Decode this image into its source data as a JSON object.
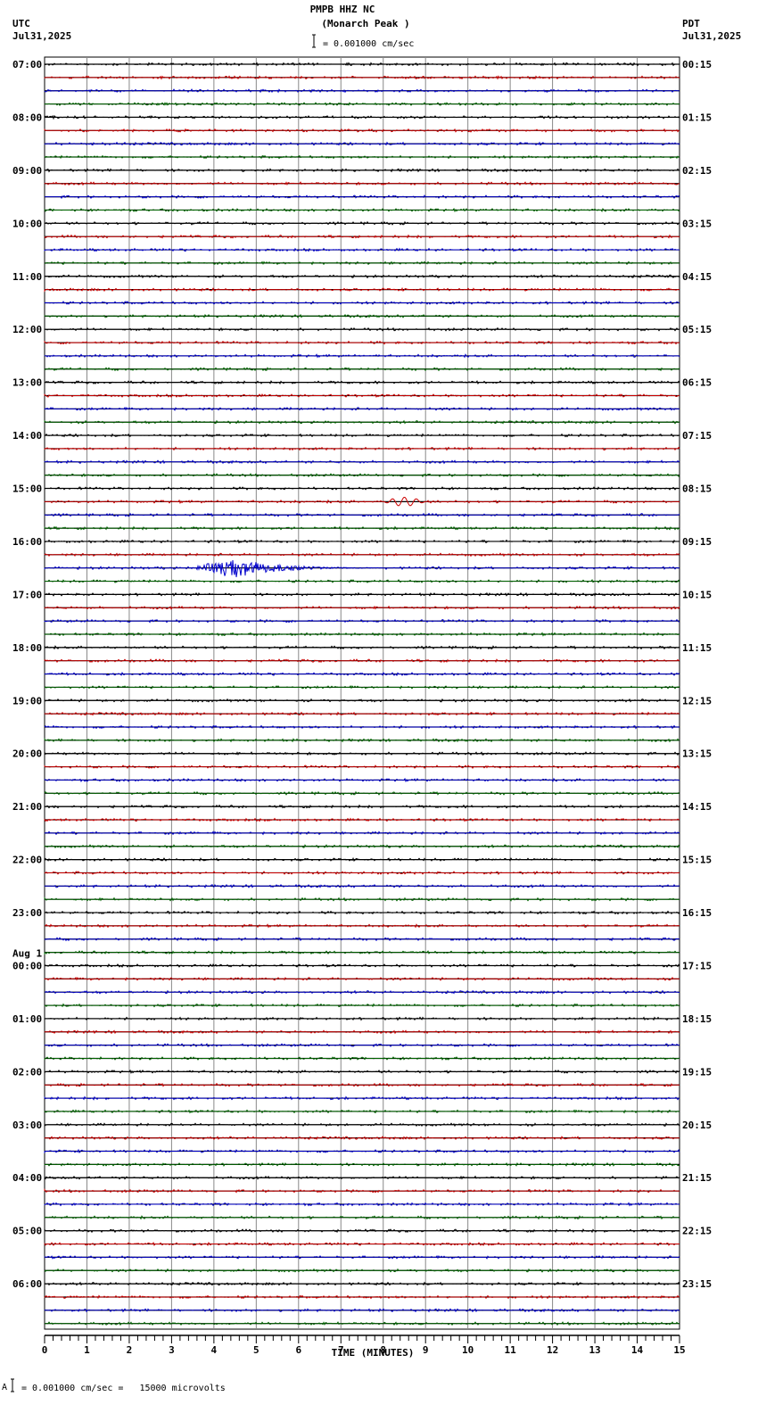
{
  "header": {
    "station": "PMPB HHZ NC",
    "location": "(Monarch Peak )",
    "left_tz": "UTC",
    "left_date": "Jul31,2025",
    "right_tz": "PDT",
    "right_date": "Jul31,2025",
    "scale_text": "= 0.001000 cm/sec"
  },
  "footer": {
    "scale_prefix": "A",
    "scale_text": "= 0.001000 cm/sec =   15000 microvolts"
  },
  "chart_data": {
    "type": "line",
    "title": "PMPB HHZ NC (Monarch Peak )",
    "xlabel": "TIME (MINUTES)",
    "xlim": [
      0,
      15
    ],
    "x_ticks": [
      "0",
      "1",
      "2",
      "3",
      "4",
      "5",
      "6",
      "7",
      "8",
      "9",
      "10",
      "11",
      "12",
      "13",
      "14",
      "15"
    ],
    "traces_per_hour": 4,
    "trace_count": 96,
    "trace_colors": [
      "#000000",
      "#cc0000",
      "#0000cc",
      "#006600"
    ],
    "date_change_label": "Aug 1",
    "date_change_before": "00:00",
    "left_labels": [
      "07:00",
      "08:00",
      "09:00",
      "10:00",
      "11:00",
      "12:00",
      "13:00",
      "14:00",
      "15:00",
      "16:00",
      "17:00",
      "18:00",
      "19:00",
      "20:00",
      "21:00",
      "22:00",
      "23:00",
      "00:00",
      "01:00",
      "02:00",
      "03:00",
      "04:00",
      "05:00",
      "06:00"
    ],
    "right_labels": [
      "00:15",
      "01:15",
      "02:15",
      "03:15",
      "04:15",
      "05:15",
      "06:15",
      "07:15",
      "08:15",
      "09:15",
      "10:15",
      "11:15",
      "12:15",
      "13:15",
      "14:15",
      "15:15",
      "16:15",
      "17:15",
      "18:15",
      "19:15",
      "20:15",
      "21:15",
      "22:15",
      "23:15"
    ],
    "noise_amplitude": 1.5,
    "events": [
      {
        "trace_index": 33,
        "start_min": 8.0,
        "end_min": 9.0,
        "amplitude": 5,
        "kind": "wave"
      },
      {
        "trace_index": 38,
        "start_min": 3.4,
        "end_min": 8.0,
        "peak_min": 4.5,
        "amplitude": 12,
        "kind": "burst"
      }
    ]
  }
}
